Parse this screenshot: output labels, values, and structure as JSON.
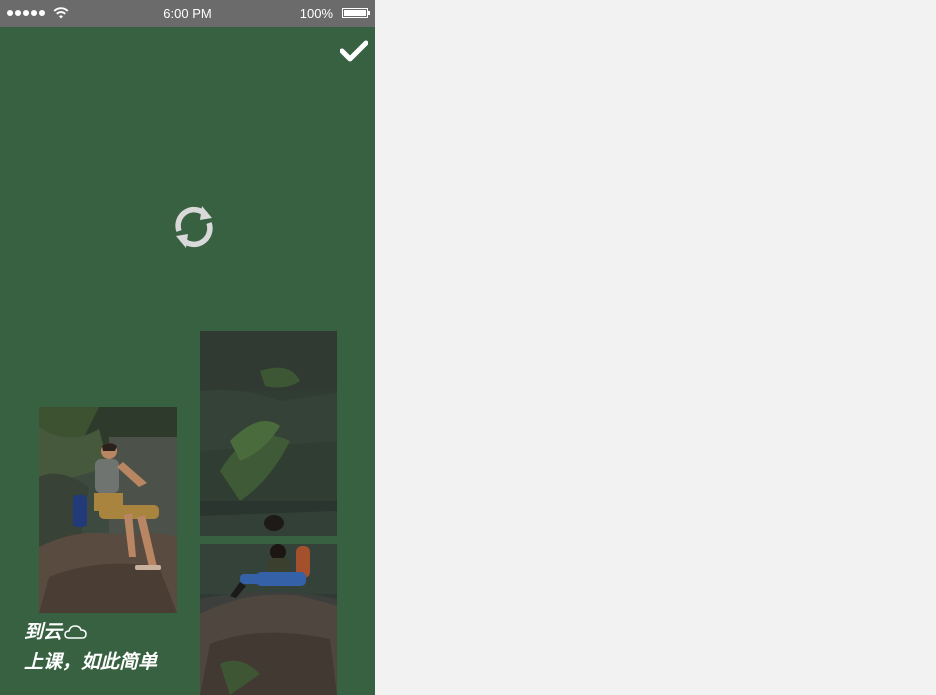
{
  "statusbar": {
    "time": "6:00 PM",
    "battery_text": "100%"
  },
  "toolbar": {
    "confirm_icon": "check-icon",
    "refresh_icon": "refresh-icon"
  },
  "photos": [
    {
      "name": "photo-man-on-rock"
    },
    {
      "name": "photo-rock-wall"
    },
    {
      "name": "photo-woman-on-rock"
    }
  ],
  "slogan": {
    "line1": "到云",
    "line2": "上课，如此简单"
  },
  "colors": {
    "background": "#376141",
    "statusbar": "#6b6b6b",
    "icon": "#d9d9d9",
    "page": "#f2f2f2"
  }
}
